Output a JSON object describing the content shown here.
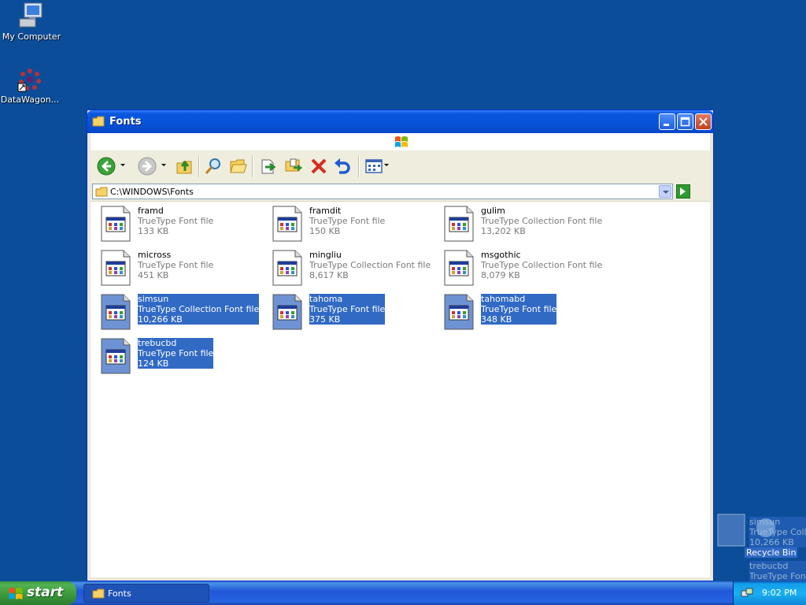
{
  "desktop": {
    "icons": [
      {
        "label": "My Computer"
      },
      {
        "label": "DataWagon..."
      }
    ],
    "recycle_bin": "Recycle Bin"
  },
  "window": {
    "title": "Fonts",
    "address": "C:\\WINDOWS\\Fonts"
  },
  "files": [
    {
      "name": "framd",
      "type": "TrueType Font file",
      "size": "133 KB",
      "selected": false
    },
    {
      "name": "framdit",
      "type": "TrueType Font file",
      "size": "150 KB",
      "selected": false
    },
    {
      "name": "gulim",
      "type": "TrueType Collection Font file",
      "size": "13,202 KB",
      "selected": false
    },
    {
      "name": "micross",
      "type": "TrueType Font file",
      "size": "451 KB",
      "selected": false
    },
    {
      "name": "mingliu",
      "type": "TrueType Collection Font file",
      "size": "8,617 KB",
      "selected": false
    },
    {
      "name": "msgothic",
      "type": "TrueType Collection Font file",
      "size": "8,079 KB",
      "selected": false
    },
    {
      "name": "simsun",
      "type": "TrueType Collection Font file",
      "size": "10,266 KB",
      "selected": true
    },
    {
      "name": "tahoma",
      "type": "TrueType Font file",
      "size": "375 KB",
      "selected": true
    },
    {
      "name": "tahomabd",
      "type": "TrueType Font file",
      "size": "348 KB",
      "selected": true
    },
    {
      "name": "trebucbd",
      "type": "TrueType Font file",
      "size": "124 KB",
      "selected": true
    }
  ],
  "drag_ghost": {
    "name": "simsun",
    "type": "TrueType Colle",
    "size": "10,266 KB",
    "name2": "trebucbd",
    "type2": "TrueType Font"
  },
  "taskbar": {
    "start_label": "start",
    "task_label": "Fonts",
    "clock": "9:02 PM"
  },
  "colors": {
    "desktop": "#0b4d99",
    "selection": "#316ac5",
    "titlebar": "#0653d7"
  }
}
